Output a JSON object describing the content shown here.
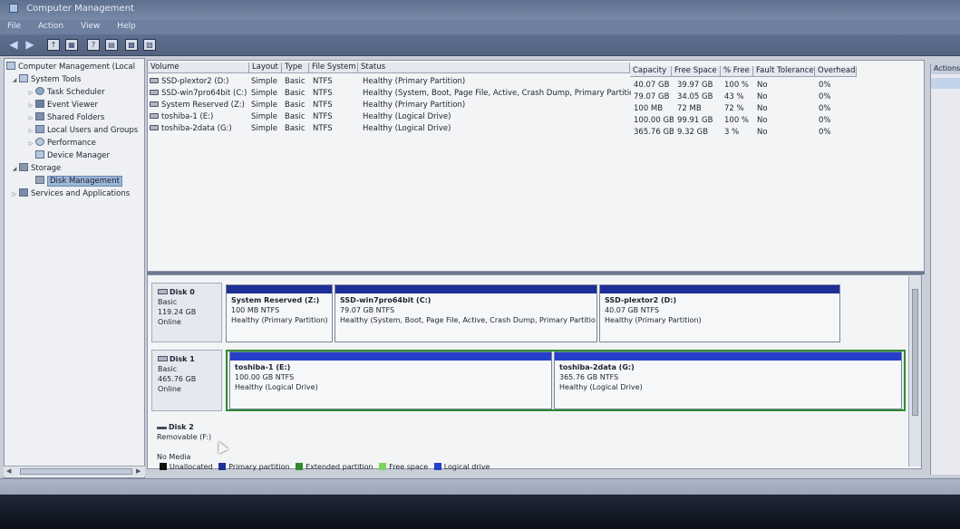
{
  "window": {
    "title": "Computer Management",
    "menu": [
      "File",
      "Action",
      "View",
      "Help"
    ]
  },
  "toolbar": {
    "buttons": [
      "back-icon",
      "forward-icon",
      "up-icon",
      "show-hide-tree-icon",
      "help-icon",
      "properties-icon",
      "disk-list-icon",
      "disk-graph-icon"
    ]
  },
  "tree": {
    "root": "Computer Management (Local",
    "system_tools": "System Tools",
    "task_scheduler": "Task Scheduler",
    "event_viewer": "Event Viewer",
    "shared_folders": "Shared Folders",
    "local_users": "Local Users and Groups",
    "performance": "Performance",
    "device_manager": "Device Manager",
    "storage": "Storage",
    "disk_management": "Disk Management",
    "services": "Services and Applications"
  },
  "volume_table": {
    "headers": {
      "volume": "Volume",
      "layout": "Layout",
      "type": "Type",
      "fs": "File System",
      "status": "Status",
      "capacity": "Capacity",
      "free": "Free Space",
      "pct": "% Free",
      "fault": "Fault Tolerance",
      "overhead": "Overhead"
    },
    "rows": [
      {
        "volume": "SSD-plextor2 (D:)",
        "layout": "Simple",
        "type": "Basic",
        "fs": "NTFS",
        "status": "Healthy (Primary Partition)",
        "capacity": "40.07 GB",
        "free": "39.97 GB",
        "pct": "100 %",
        "fault": "No",
        "overhead": "0%"
      },
      {
        "volume": "SSD-win7pro64bit (C:)",
        "layout": "Simple",
        "type": "Basic",
        "fs": "NTFS",
        "status": "Healthy (System, Boot, Page File, Active, Crash Dump, Primary Partition)",
        "capacity": "79.07 GB",
        "free": "34.05 GB",
        "pct": "43 %",
        "fault": "No",
        "overhead": "0%"
      },
      {
        "volume": "System Reserved (Z:)",
        "layout": "Simple",
        "type": "Basic",
        "fs": "NTFS",
        "status": "Healthy (Primary Partition)",
        "capacity": "100 MB",
        "free": "72 MB",
        "pct": "72 %",
        "fault": "No",
        "overhead": "0%"
      },
      {
        "volume": "toshiba-1 (E:)",
        "layout": "Simple",
        "type": "Basic",
        "fs": "NTFS",
        "status": "Healthy (Logical Drive)",
        "capacity": "100.00 GB",
        "free": "99.91 GB",
        "pct": "100 %",
        "fault": "No",
        "overhead": "0%"
      },
      {
        "volume": "toshiba-2data (G:)",
        "layout": "Simple",
        "type": "Basic",
        "fs": "NTFS",
        "status": "Healthy (Logical Drive)",
        "capacity": "365.76 GB",
        "free": "9.32 GB",
        "pct": "3 %",
        "fault": "No",
        "overhead": "0%"
      }
    ]
  },
  "disks": {
    "disk0": {
      "name": "Disk 0",
      "type": "Basic",
      "size": "119.24 GB",
      "state": "Online",
      "partitions": [
        {
          "name": "System Reserved  (Z:)",
          "size": "100 MB NTFS",
          "status": "Healthy (Primary Partition)"
        },
        {
          "name": "SSD-win7pro64bit  (C:)",
          "size": "79.07 GB NTFS",
          "status": "Healthy (System, Boot, Page File, Active, Crash Dump, Primary Partitio"
        },
        {
          "name": "SSD-plextor2  (D:)",
          "size": "40.07 GB NTFS",
          "status": "Healthy (Primary Partition)"
        }
      ]
    },
    "disk1": {
      "name": "Disk 1",
      "type": "Basic",
      "size": "465.76 GB",
      "state": "Online",
      "partitions": [
        {
          "name": "toshiba-1  (E:)",
          "size": "100.00 GB NTFS",
          "status": "Healthy (Logical Drive)"
        },
        {
          "name": "toshiba-2data  (G:)",
          "size": "365.76 GB NTFS",
          "status": "Healthy (Logical Drive)"
        }
      ]
    },
    "disk2": {
      "name": "Disk 2",
      "type": "Removable (F:)",
      "state": "No Media"
    }
  },
  "legend": {
    "unallocated": "Unallocated",
    "primary": "Primary partition",
    "extended": "Extended partition",
    "free": "Free space",
    "logical": "Logical drive",
    "colors": {
      "unallocated": "#111111",
      "primary": "#1d2f96",
      "extended": "#2f8a2f",
      "free": "#7fd35a",
      "logical": "#2440c8"
    }
  },
  "actions": {
    "title": "Actions"
  }
}
